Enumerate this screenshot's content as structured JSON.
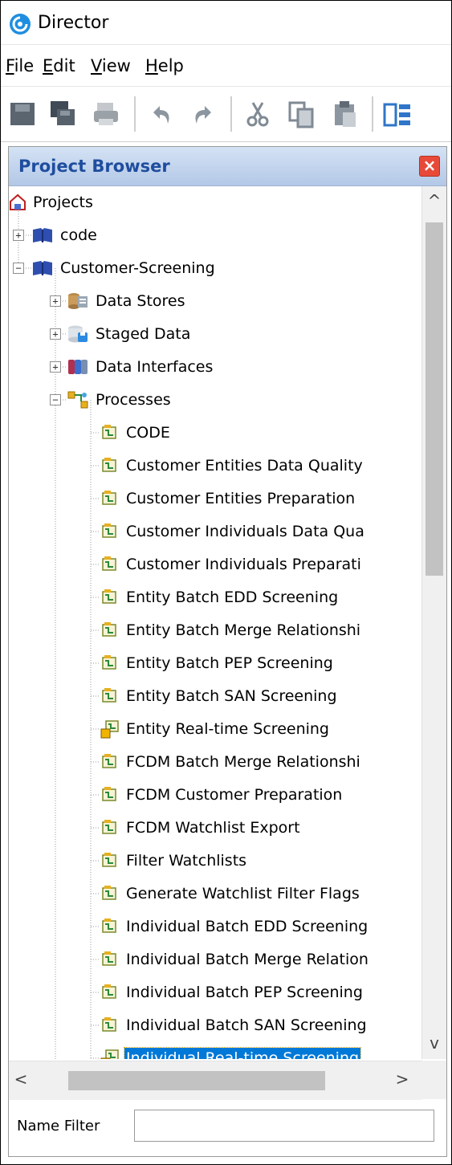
{
  "window": {
    "title": "Director",
    "app_icon": "director-logo-icon"
  },
  "menubar": {
    "items": [
      {
        "mnemonic": "F",
        "rest": "ile"
      },
      {
        "mnemonic": "E",
        "rest": "dit"
      },
      {
        "mnemonic": "V",
        "rest": "iew"
      },
      {
        "mnemonic": "H",
        "rest": "elp"
      }
    ]
  },
  "toolbar": {
    "icons": [
      "save-icon",
      "save-all-icon",
      "print-icon",
      "undo-icon",
      "redo-icon",
      "cut-icon",
      "copy-icon",
      "paste-icon",
      "layout-icon"
    ]
  },
  "project_browser": {
    "title": "Project Browser",
    "close_glyph": "×",
    "tree": [
      {
        "label": "Projects",
        "icon": "projects-icon",
        "level": 0,
        "expander": ""
      },
      {
        "label": "code",
        "icon": "project-book-icon",
        "level": 1,
        "expander": "+"
      },
      {
        "label": "Customer-Screening",
        "icon": "project-book-icon",
        "level": 1,
        "expander": "−"
      },
      {
        "label": "Data Stores",
        "icon": "data-stores-icon",
        "level": 2,
        "expander": "+"
      },
      {
        "label": "Staged Data",
        "icon": "staged-data-icon",
        "level": 2,
        "expander": "+"
      },
      {
        "label": "Data Interfaces",
        "icon": "data-interfaces-icon",
        "level": 2,
        "expander": "+"
      },
      {
        "label": "Processes",
        "icon": "processes-icon",
        "level": 2,
        "expander": "−"
      },
      {
        "label": "CODE",
        "icon": "process-icon",
        "level": 3
      },
      {
        "label": "Customer Entities Data Quality",
        "icon": "process-icon",
        "level": 3
      },
      {
        "label": "Customer Entities Preparation",
        "icon": "process-icon",
        "level": 3
      },
      {
        "label": "Customer Individuals Data Qua",
        "icon": "process-icon",
        "level": 3
      },
      {
        "label": "Customer Individuals Preparati",
        "icon": "process-icon",
        "level": 3
      },
      {
        "label": "Entity Batch EDD Screening",
        "icon": "process-icon",
        "level": 3
      },
      {
        "label": "Entity Batch Merge Relationshi",
        "icon": "process-icon",
        "level": 3
      },
      {
        "label": "Entity Batch PEP Screening",
        "icon": "process-icon",
        "level": 3
      },
      {
        "label": "Entity Batch SAN Screening",
        "icon": "process-icon",
        "level": 3
      },
      {
        "label": "Entity Real-time Screening",
        "icon": "realtime-process-icon",
        "level": 3
      },
      {
        "label": "FCDM Batch Merge Relationshi",
        "icon": "process-icon",
        "level": 3
      },
      {
        "label": "FCDM Customer Preparation",
        "icon": "process-icon",
        "level": 3
      },
      {
        "label": "FCDM Watchlist Export",
        "icon": "process-icon",
        "level": 3
      },
      {
        "label": "Filter Watchlists",
        "icon": "process-icon",
        "level": 3
      },
      {
        "label": "Generate Watchlist Filter Flags",
        "icon": "process-icon",
        "level": 3
      },
      {
        "label": "Individual Batch EDD Screening",
        "icon": "process-icon",
        "level": 3
      },
      {
        "label": "Individual Batch Merge Relation",
        "icon": "process-icon",
        "level": 3
      },
      {
        "label": "Individual Batch PEP Screening",
        "icon": "process-icon",
        "level": 3
      },
      {
        "label": "Individual Batch SAN Screening",
        "icon": "process-icon",
        "level": 3
      },
      {
        "label": "Individual Real-time Screening",
        "icon": "realtime-process-icon",
        "level": 3,
        "selected": true
      }
    ]
  },
  "scrollbars": {
    "up": "^",
    "down": "v",
    "left": "<",
    "right": ">"
  },
  "name_filter": {
    "label": "Name Filter",
    "value": ""
  }
}
